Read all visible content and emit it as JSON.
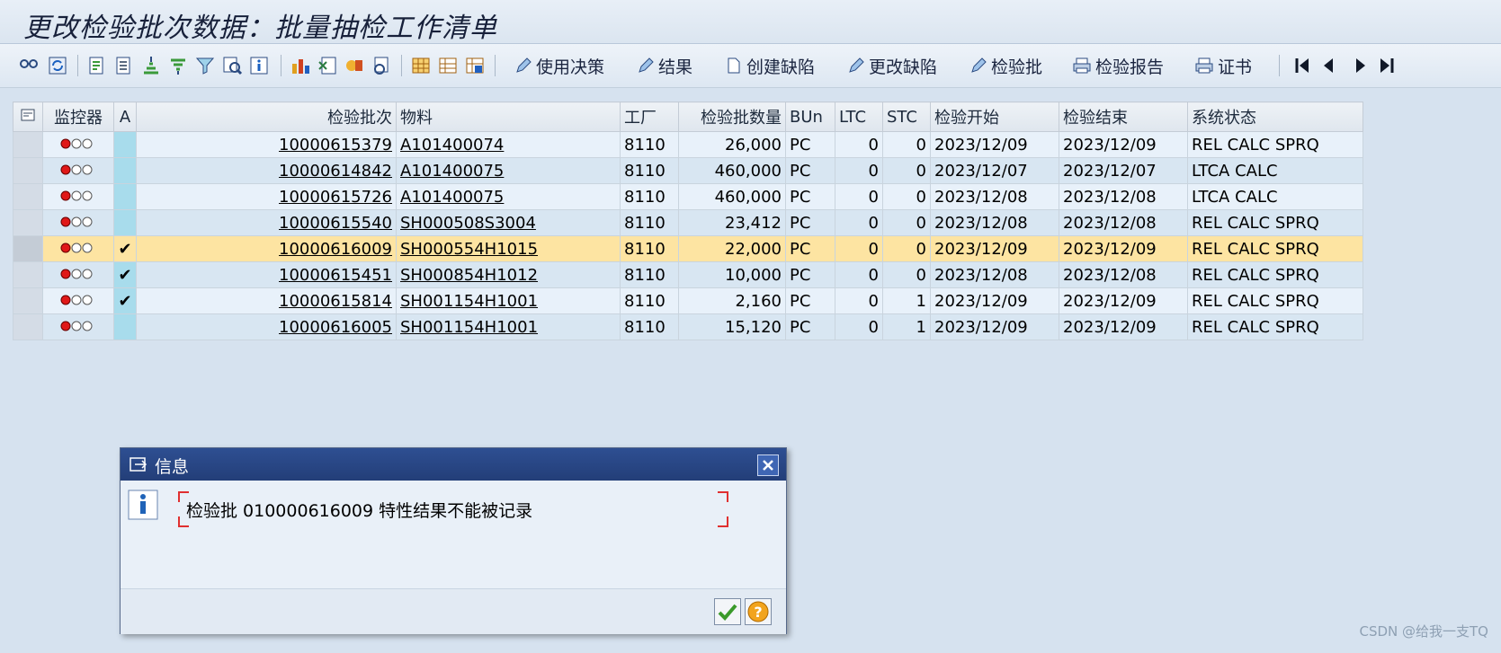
{
  "title": "更改检验批次数据：批量抽检工作清单",
  "toolbar": {
    "buttons": [
      {
        "label": "使用决策",
        "icon": "pencil-icon"
      },
      {
        "label": "结果",
        "icon": "pencil-icon"
      },
      {
        "label": "创建缺陷",
        "icon": "document-icon"
      },
      {
        "label": "更改缺陷",
        "icon": "pencil-icon"
      },
      {
        "label": "检验批",
        "icon": "pencil-icon"
      },
      {
        "label": "检验报告",
        "icon": "printer-icon"
      },
      {
        "label": "证书",
        "icon": "printer-icon"
      }
    ]
  },
  "table": {
    "headers": {
      "monitor": "监控器",
      "a": "A",
      "lot": "检验批次",
      "material": "物料",
      "plant": "工厂",
      "qty": "检验批数量",
      "bun": "BUn",
      "ltc": "LTC",
      "stc": "STC",
      "start": "检验开始",
      "end": "检验结束",
      "status": "系统状态"
    },
    "rows": [
      {
        "a": "",
        "lot": "10000615379",
        "material": "A101400074",
        "plant": "8110",
        "qty": "26,000",
        "bun": "PC",
        "ltc": "0",
        "stc": "0",
        "start": "2023/12/09",
        "end": "2023/12/09",
        "status": "REL  CALC SPRQ"
      },
      {
        "a": "",
        "lot": "10000614842",
        "material": "A101400075",
        "plant": "8110",
        "qty": "460,000",
        "bun": "PC",
        "ltc": "0",
        "stc": "0",
        "start": "2023/12/07",
        "end": "2023/12/07",
        "status": "LTCA CALC"
      },
      {
        "a": "",
        "lot": "10000615726",
        "material": "A101400075",
        "plant": "8110",
        "qty": "460,000",
        "bun": "PC",
        "ltc": "0",
        "stc": "0",
        "start": "2023/12/08",
        "end": "2023/12/08",
        "status": "LTCA CALC"
      },
      {
        "a": "",
        "lot": "10000615540",
        "material": "SH000508S3004",
        "plant": "8110",
        "qty": "23,412",
        "bun": "PC",
        "ltc": "0",
        "stc": "0",
        "start": "2023/12/08",
        "end": "2023/12/08",
        "status": "REL  CALC SPRQ"
      },
      {
        "a": "✔",
        "lot": "10000616009",
        "material": "SH000554H1015",
        "plant": "8110",
        "qty": "22,000",
        "bun": "PC",
        "ltc": "0",
        "stc": "0",
        "start": "2023/12/09",
        "end": "2023/12/09",
        "status": "REL  CALC SPRQ"
      },
      {
        "a": "✔",
        "lot": "10000615451",
        "material": "SH000854H1012",
        "plant": "8110",
        "qty": "10,000",
        "bun": "PC",
        "ltc": "0",
        "stc": "0",
        "start": "2023/12/08",
        "end": "2023/12/08",
        "status": "REL  CALC SPRQ"
      },
      {
        "a": "✔",
        "lot": "10000615814",
        "material": "SH001154H1001",
        "plant": "8110",
        "qty": "2,160",
        "bun": "PC",
        "ltc": "0",
        "stc": "1",
        "start": "2023/12/09",
        "end": "2023/12/09",
        "status": "REL  CALC SPRQ"
      },
      {
        "a": "",
        "lot": "10000616005",
        "material": "SH001154H1001",
        "plant": "8110",
        "qty": "15,120",
        "bun": "PC",
        "ltc": "0",
        "stc": "1",
        "start": "2023/12/09",
        "end": "2023/12/09",
        "status": "REL  CALC SPRQ"
      }
    ]
  },
  "dialog": {
    "title": "信息",
    "message": "检验批 010000616009 特性结果不能被记录"
  },
  "watermark": "CSDN @给我一支TQ"
}
